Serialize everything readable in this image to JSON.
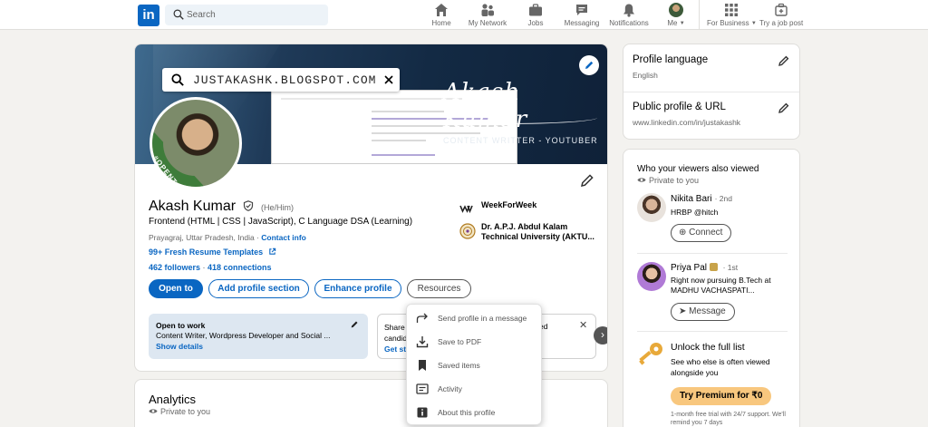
{
  "nav": {
    "logo": "in",
    "search_placeholder": "Search",
    "items": [
      {
        "label": "Home",
        "icon": "home-icon"
      },
      {
        "label": "My Network",
        "icon": "network-icon"
      },
      {
        "label": "Jobs",
        "icon": "briefcase-icon"
      },
      {
        "label": "Messaging",
        "icon": "chat-icon"
      },
      {
        "label": "Notifications",
        "icon": "bell-icon"
      },
      {
        "label": "Me"
      },
      {
        "label": "For Business"
      },
      {
        "label": "Try a job post"
      }
    ]
  },
  "banner": {
    "search_text": "JUSTAKASHK.BLOGSPOT.COM",
    "signature": "Akash Kumar",
    "subtitle": "CONTENT WRITTER -  YOUTUBER",
    "photo_badge": "#OPENTOWORK"
  },
  "profile": {
    "name": "Akash Kumar",
    "pronouns": "(He/Him)",
    "headline": "Frontend (HTML | CSS | JavaScript), C Language DSA (Learning)",
    "location": "Prayagraj, Uttar Pradesh, India · ",
    "contact_info": "Contact info",
    "resume_link": "99+ Fresh Resume Templates",
    "followers": "462 followers",
    "separator": " · ",
    "connections": "418 connections",
    "experience": [
      {
        "name": "WeekForWeek"
      },
      {
        "name": "Dr. A.P.J. Abdul Kalam Technical University (AKTU..."
      }
    ]
  },
  "actions": {
    "open_to": "Open to",
    "add_section": "Add profile section",
    "enhance": "Enhance profile",
    "resources": "Resources"
  },
  "open_to_work": {
    "title": "Open to work",
    "desc": "Content Writer, Wordpress Developer and Social ...",
    "link": "Show details"
  },
  "share_card": {
    "line1": "Share",
    "line2": "candid",
    "link": "Get st",
    "tail": "ed"
  },
  "resources_menu": [
    {
      "label": "Send profile in a message",
      "icon": "share-arrow-icon"
    },
    {
      "label": "Save to PDF",
      "icon": "download-icon"
    },
    {
      "label": "Saved items",
      "icon": "bookmark-icon"
    },
    {
      "label": "Activity",
      "icon": "activity-icon"
    },
    {
      "label": "About this profile",
      "icon": "info-icon"
    }
  ],
  "analytics": {
    "title": "Analytics",
    "sub": "Private to you"
  },
  "sidebar": {
    "profile_language": {
      "title": "Profile language",
      "value": "English"
    },
    "public_profile": {
      "title": "Public profile & URL",
      "value": "www.linkedin.com/in/justakashk"
    }
  },
  "viewers": {
    "title": "Who your viewers also viewed",
    "sub": "Private to you",
    "people": [
      {
        "name": "Nikita Bari",
        "degree": "· 2nd",
        "title": "HRBP @hitch",
        "button": "Connect"
      },
      {
        "name": "Priya Pal",
        "degree": "· 1st",
        "title": "Right now pursuing B.Tech at MADHU VACHASPATI...",
        "button": "Message"
      }
    ],
    "premium": {
      "title": "Unlock the full list",
      "desc": "See who else is often viewed alongside you",
      "button": "Try Premium for ₹0",
      "note": "1-month free trial with 24/7 support. We'll remind you 7 days"
    }
  },
  "colors": {
    "brand": "#0a66c2",
    "open_to_work_green": "#3e7c3a",
    "premium_gold": "#f8c77e"
  }
}
